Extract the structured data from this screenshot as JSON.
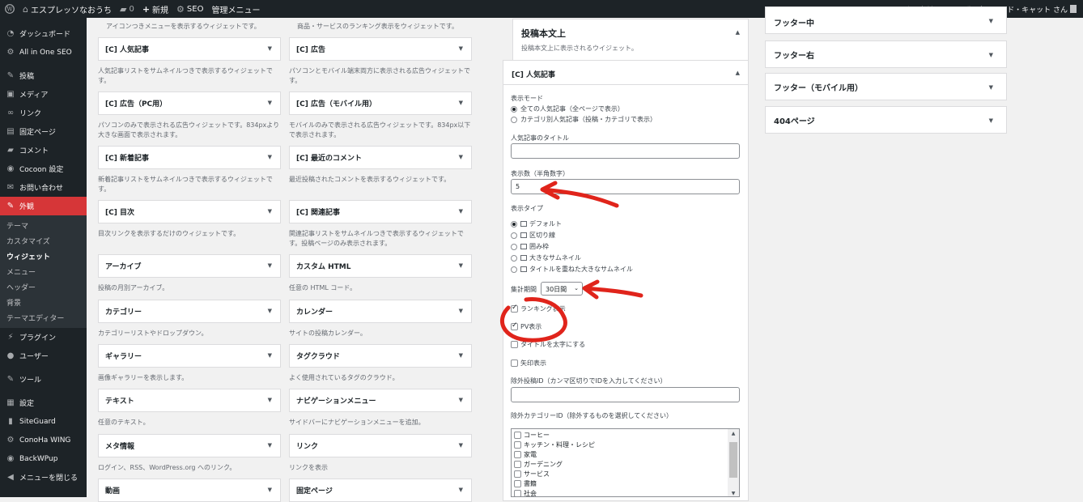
{
  "adminbar": {
    "site_name": "エスプレッソなおうち",
    "comments": "0",
    "new": "新規",
    "seo": "SEO",
    "admin_menu": "管理メニュー",
    "greeting": "こんにちは、ルル・ザ・タキシード・キャット さん"
  },
  "sidebar": {
    "items": [
      {
        "label": "ダッシュボード",
        "icon": "dashboard-icon"
      },
      {
        "label": "All in One SEO",
        "icon": "seo-icon"
      },
      {
        "label": "投稿",
        "icon": "pin-icon"
      },
      {
        "label": "メディア",
        "icon": "media-icon"
      },
      {
        "label": "リンク",
        "icon": "link-icon"
      },
      {
        "label": "固定ページ",
        "icon": "page-icon"
      },
      {
        "label": "コメント",
        "icon": "comment-icon"
      },
      {
        "label": "Cocoon 設定",
        "icon": "cocoon-icon"
      },
      {
        "label": "お問い合わせ",
        "icon": "mail-icon"
      },
      {
        "label": "外観",
        "icon": "appearance-icon"
      }
    ],
    "submenu": [
      "テーマ",
      "カスタマイズ",
      "ウィジェット",
      "メニュー",
      "ヘッダー",
      "背景",
      "テーマエディター"
    ],
    "items2": [
      {
        "label": "プラグイン",
        "icon": "plugin-icon"
      },
      {
        "label": "ユーザー",
        "icon": "user-icon"
      },
      {
        "label": "ツール",
        "icon": "tool-icon"
      },
      {
        "label": "設定",
        "icon": "settings-icon"
      },
      {
        "label": "SiteGuard",
        "icon": "siteguard-icon"
      },
      {
        "label": "ConoHa WING",
        "icon": "conoha-icon"
      },
      {
        "label": "BackWPup",
        "icon": "backwpup-icon"
      },
      {
        "label": "メニューを閉じる",
        "icon": "collapse-icon"
      }
    ]
  },
  "widgets": {
    "top_desc_left": "アイコンつきメニューを表示するウィジェットです。",
    "top_desc_right": "商品・サービスのランキング表示をウィジェットです。",
    "left": [
      {
        "title": "[C] 人気記事",
        "desc": "人気記事リストをサムネイルつきで表示するウィジェットです。"
      },
      {
        "title": "[C] 広告（PC用）",
        "desc": "パソコンのみで表示される広告ウィジェットです。834pxより大きな画面で表示されます。"
      },
      {
        "title": "[C] 新着記事",
        "desc": "新着記事リストをサムネイルつきで表示するウィジェットです。"
      },
      {
        "title": "[C] 目次",
        "desc": "目次リンクを表示するだけのウィジェットです。"
      },
      {
        "title": "アーカイブ",
        "desc": "投稿の月別アーカイブ。"
      },
      {
        "title": "カテゴリー",
        "desc": "カテゴリーリストやドロップダウン。"
      },
      {
        "title": "ギャラリー",
        "desc": "画像ギャラリーを表示します。"
      },
      {
        "title": "テキスト",
        "desc": "任意のテキスト。"
      },
      {
        "title": "メタ情報",
        "desc": "ログイン、RSS、WordPress.org へのリンク。"
      },
      {
        "title": "動画",
        "desc": ""
      }
    ],
    "right": [
      {
        "title": "[C] 広告",
        "desc": "パソコンとモバイル端末両方に表示される広告ウィジェットです。"
      },
      {
        "title": "[C] 広告（モバイル用）",
        "desc": "モバイルのみで表示される広告ウィジェットです。834px以下で表示されます。"
      },
      {
        "title": "[C] 最近のコメント",
        "desc": "最近投稿されたコメントを表示するウィジェットです。"
      },
      {
        "title": "[C] 関連記事",
        "desc": "関連記事リストをサムネイルつきで表示するウィジェットです。投稿ページのみ表示されます。"
      },
      {
        "title": "カスタム HTML",
        "desc": "任意の HTML コード。"
      },
      {
        "title": "カレンダー",
        "desc": "サイトの投稿カレンダー。"
      },
      {
        "title": "タグクラウド",
        "desc": "よく使用されているタグのクラウド。"
      },
      {
        "title": "ナビゲーションメニュー",
        "desc": "サイドバーにナビゲーションメニューを追加。"
      },
      {
        "title": "リンク",
        "desc": "リンクを表示"
      },
      {
        "title": "固定ページ",
        "desc": ""
      }
    ]
  },
  "area": {
    "title": "投稿本文上",
    "desc": "投稿本文上に表示されるウイジェット。",
    "widget_title": "[C] 人気記事",
    "display_mode_label": "表示モード",
    "mode_all": "全ての人気記事（全ページで表示）",
    "mode_cat": "カテゴリ別人気記事（投稿・カテゴリで表示）",
    "title_label": "人気記事のタイトル",
    "count_label": "表示数（半角数字）",
    "count_value": "5",
    "type_label": "表示タイプ",
    "types": [
      "デフォルト",
      "区切り線",
      "囲み枠",
      "大きなサムネイル",
      "タイトルを重ねた大きなサムネイル"
    ],
    "period_label": "集計期間",
    "period_value": "30日間",
    "ranking": "ランキング表示",
    "pv": "PV表示",
    "bold": "タイトルを太字にする",
    "arrow": "矢印表示",
    "exclude_post_label": "除外投稿ID（カンマ区切りでIDを入力してください）",
    "exclude_cat_label": "除外カテゴリーID（除外するものを選択してください）",
    "categories": [
      "コーヒー",
      "キッチン・料理・レシピ",
      "家電",
      "ガーデニング",
      "サービス",
      "書籍",
      "社会"
    ]
  },
  "right_areas": [
    "フッター中",
    "フッター右",
    "フッター（モバイル用）",
    "404ページ"
  ],
  "colors": {
    "accent_red": "#e0241b",
    "admin_bg": "#1d2327"
  }
}
